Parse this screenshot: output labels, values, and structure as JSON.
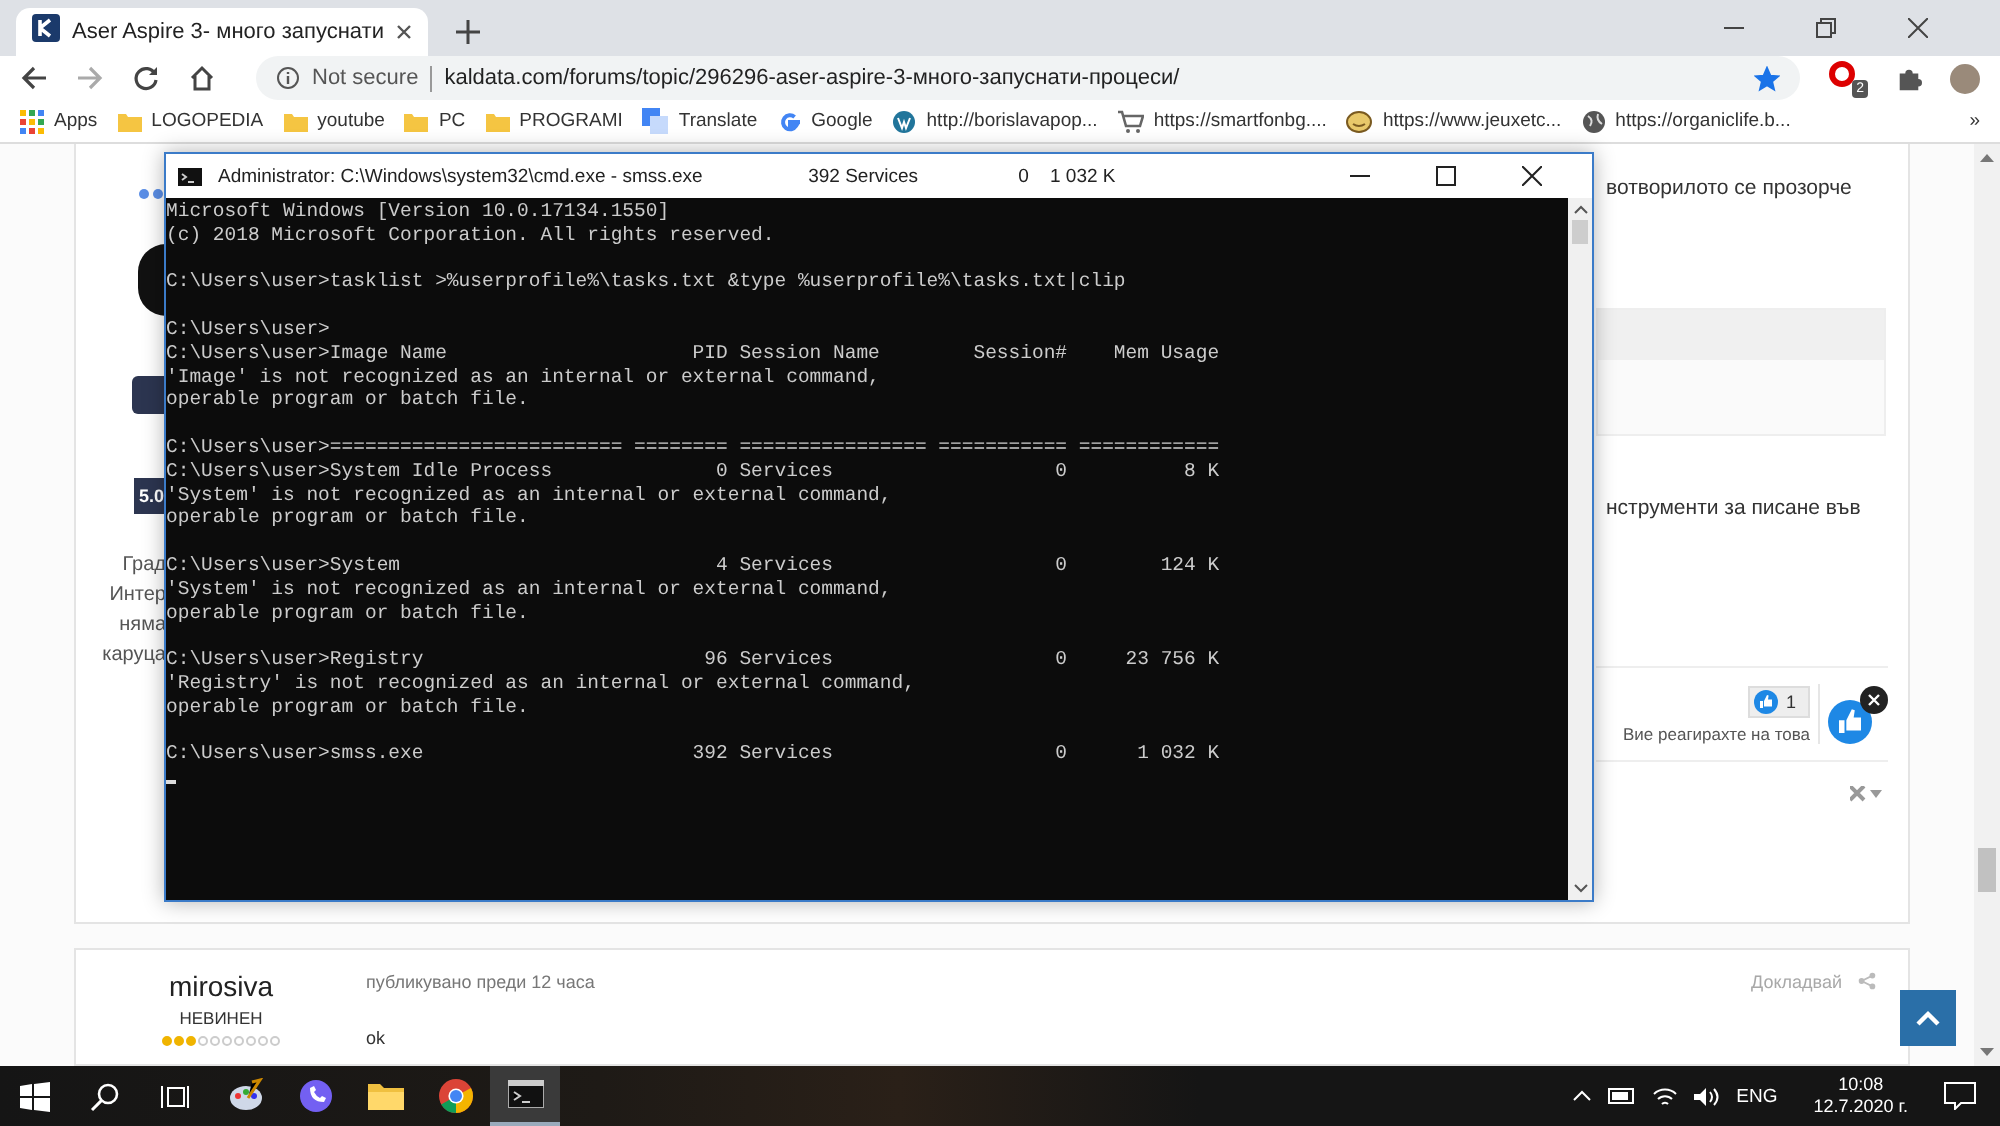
{
  "browser": {
    "tabs": [
      {
        "title": "Aser Aspire 3- много запуснати",
        "selected": true
      }
    ],
    "address": {
      "security": "Not secure",
      "url": "kaldata.com/forums/topic/296296-aser-aspire-3-много-запуснати-процеси/",
      "bookmarked": true
    },
    "extension_badge": "2",
    "bookmarks": [
      {
        "label": "Apps",
        "kind": "apps"
      },
      {
        "label": "LOGOPEDIA",
        "kind": "folder"
      },
      {
        "label": "youtube",
        "kind": "folder"
      },
      {
        "label": "PC",
        "kind": "folder"
      },
      {
        "label": "PROGRAMI",
        "kind": "folder"
      },
      {
        "label": "Translate",
        "kind": "translate"
      },
      {
        "label": "Google",
        "kind": "google"
      },
      {
        "label": "http://borislavapop...",
        "kind": "wordpress"
      },
      {
        "label": "https://smartfonbg....",
        "kind": "cart"
      },
      {
        "label": "https://www.jeuxetc...",
        "kind": "smiley"
      },
      {
        "label": "https://organiclife.b...",
        "kind": "globe"
      }
    ],
    "bookmarks_more": "»"
  },
  "page": {
    "post": {
      "author_fragments": [
        "Град",
        "Интер",
        "няма",
        "каруца"
      ],
      "rating_badge": "5.0",
      "text_fragments": [
        "вотворилото се прозорче",
        "нструменти за писане във"
      ],
      "reaction": {
        "count": "1",
        "note": "Вие реагирахте на това",
        "selected": true
      }
    },
    "next_post": {
      "author": "mirosiva",
      "rank": "НЕВИНЕН",
      "stars": 3,
      "posted": "публикувано преди 12 часа",
      "body": "ok",
      "report": "Докладвай"
    }
  },
  "console": {
    "title": "Administrator: C:\\Windows\\system32\\cmd.exe - smss.exe                    392 Services                   0    1 032 K",
    "blocks": [
      [
        "Microsoft Windows [Version 10.0.17134.1550]",
        "(c) 2018 Microsoft Corporation. All rights reserved."
      ],
      [
        "C:\\Users\\user>tasklist >%userprofile%\\tasks.txt &type %userprofile%\\tasks.txt|clip"
      ],
      [
        "C:\\Users\\user>",
        "C:\\Users\\user>Image Name                     PID Session Name        Session#    Mem Usage",
        "'Image' is not recognized as an internal or external command,",
        "operable program or batch file."
      ],
      [
        "C:\\Users\\user>========================= ======== ================ =========== ============",
        "C:\\Users\\user>System Idle Process              0 Services                   0          8 K",
        "'System' is not recognized as an internal or external command,",
        "operable program or batch file."
      ],
      [
        "C:\\Users\\user>System                           4 Services                   0        124 K",
        "'System' is not recognized as an internal or external command,",
        "operable program or batch file."
      ],
      [
        "C:\\Users\\user>Registry                        96 Services                   0     23 756 K",
        "'Registry' is not recognized as an internal or external command,",
        "operable program or batch file."
      ],
      [
        "C:\\Users\\user>smss.exe                       392 Services                   0      1 032 K"
      ]
    ]
  },
  "taskbar": {
    "apps": [
      {
        "kind": "windows",
        "active": false
      },
      {
        "kind": "search",
        "active": false
      },
      {
        "kind": "taskview",
        "active": false
      },
      {
        "kind": "paint",
        "active": false
      },
      {
        "kind": "viber",
        "active": false
      },
      {
        "kind": "explorer",
        "active": false
      },
      {
        "kind": "chrome",
        "active": false
      },
      {
        "kind": "console",
        "active": true
      }
    ],
    "language": "ENG",
    "time": "10:08",
    "date": "12.7.2020 г."
  }
}
